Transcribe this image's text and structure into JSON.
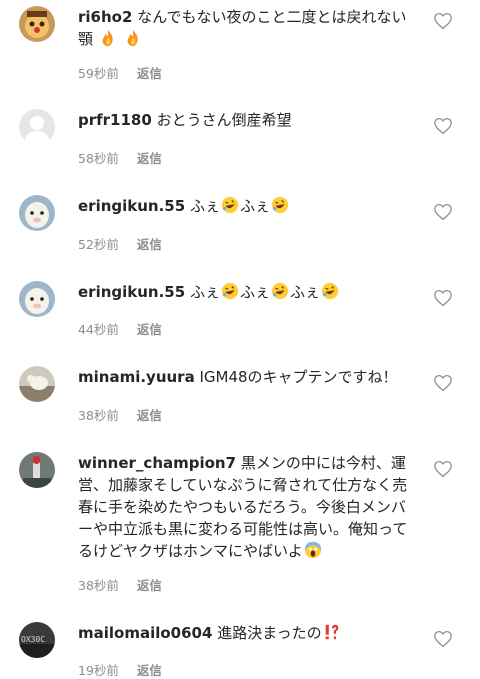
{
  "comments": [
    {
      "username": "ri6ho2",
      "body": "なんでもない夜のこと二度とは戻れない",
      "body2": "顎",
      "time": "59秒前",
      "reply": "返信"
    },
    {
      "username": "prfr1180",
      "body": "おとうさん倒産希望",
      "time": "58秒前",
      "reply": "返信"
    },
    {
      "username": "eringikun.55",
      "body": "ふぇ",
      "time": "52秒前",
      "reply": "返信"
    },
    {
      "username": "eringikun.55",
      "body": "ふぇ",
      "time": "44秒前",
      "reply": "返信"
    },
    {
      "username": "minami.yuura",
      "body": "IGM48のキャプテンですね！",
      "time": "38秒前",
      "reply": "返信"
    },
    {
      "username": "winner_champion7",
      "body": "黒メンの中には今村、運",
      "line2": "営、加藤家そしていなぷうに脅されて仕方なく売",
      "line3": "春に手を染めたやつもいるだろう。今後白メンバ",
      "line4": "ーや中立派も黒に変わる可能性は高い。俺知って",
      "line5": "るけどヤクザはホンマにやばいよ",
      "time": "38秒前",
      "reply": "返信"
    },
    {
      "username": "mailomailo0604",
      "body": "進路決まったの",
      "time": "19秒前",
      "reply": "返信"
    }
  ],
  "avatar_texts": {
    "mailomailo0604": "OX30C"
  },
  "icons": {
    "heart": "heart-outline-icon",
    "fire": "fire-emoji",
    "rofl": "rolling-laughing-emoji",
    "scream": "screaming-face-emoji",
    "exclaim": "exclamation-question-emoji"
  }
}
